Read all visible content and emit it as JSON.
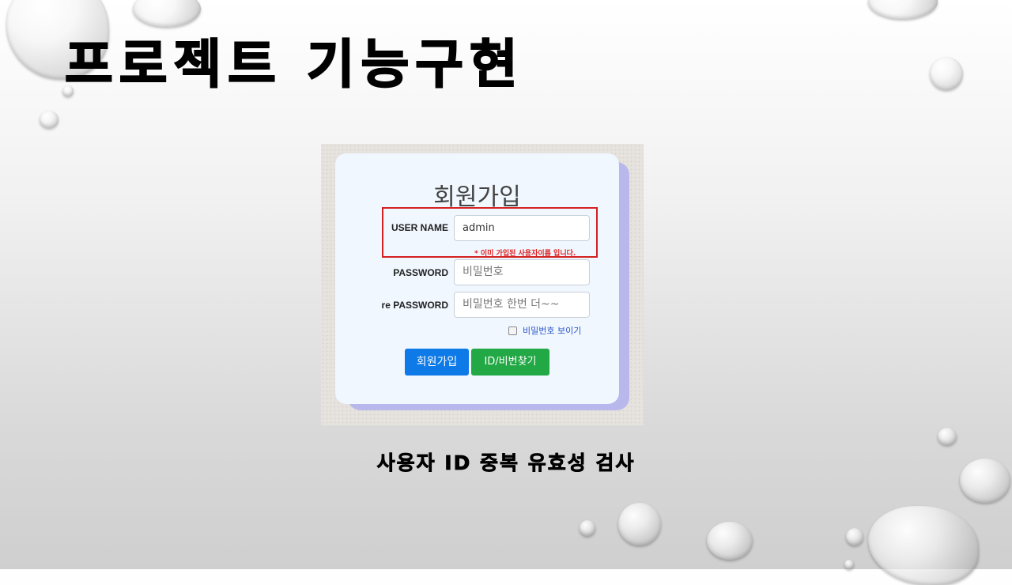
{
  "slide": {
    "title": "프로젝트 기능구현",
    "caption": "사용자 ID 중복 유효성 검사"
  },
  "form": {
    "title": "회원가입",
    "username_label": "USER NAME",
    "username_value": "admin",
    "username_error": "* 이미 가입된 사용자이름 입니다.",
    "password_label": "PASSWORD",
    "password_placeholder": "비밀번호",
    "repassword_label": "re PASSWORD",
    "repassword_placeholder": "비밀번호 한번 더~~",
    "show_password_label": "비밀번호 보이기",
    "signup_button": "회원가입",
    "find_button": "ID/비번찾기"
  },
  "colors": {
    "highlight_border": "#d42020",
    "error_text": "#e02020",
    "primary_button": "#0d7ae8",
    "success_button": "#22a845"
  }
}
